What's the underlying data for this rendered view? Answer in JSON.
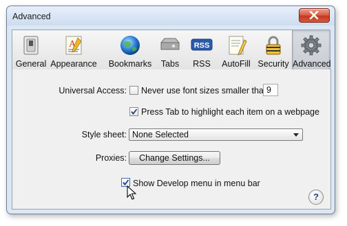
{
  "window": {
    "title": "Advanced"
  },
  "tabs": [
    {
      "label": "General",
      "icon": "general-switch-icon"
    },
    {
      "label": "Appearance",
      "icon": "appearance-font-icon"
    },
    {
      "label": "Bookmarks",
      "icon": "bookmarks-globe-icon"
    },
    {
      "label": "Tabs",
      "icon": "tabs-icon"
    },
    {
      "label": "RSS",
      "icon": "rss-icon"
    },
    {
      "label": "AutoFill",
      "icon": "autofill-pencil-icon"
    },
    {
      "label": "Security",
      "icon": "security-lock-icon"
    },
    {
      "label": "Advanced",
      "icon": "advanced-gear-icon",
      "active": true
    }
  ],
  "rss_badge": "RSS",
  "universal_access": {
    "label": "Universal Access:",
    "min_font_checkbox": {
      "label": "Never use font sizes smaller than",
      "checked": false
    },
    "min_font_size": "9",
    "press_tab_checkbox": {
      "label": "Press Tab to highlight each item on a webpage",
      "checked": true
    }
  },
  "style_sheet": {
    "label": "Style sheet:",
    "selected": "None Selected"
  },
  "proxies": {
    "label": "Proxies:",
    "button_label": "Change Settings..."
  },
  "develop_menu": {
    "label": "Show Develop menu in menu bar",
    "checked": true
  },
  "help_button": {
    "label": "?"
  },
  "colors": {
    "accent": "#2b5aa8",
    "close_button": "#c8432b",
    "window_bg": "#dbe7f5"
  }
}
